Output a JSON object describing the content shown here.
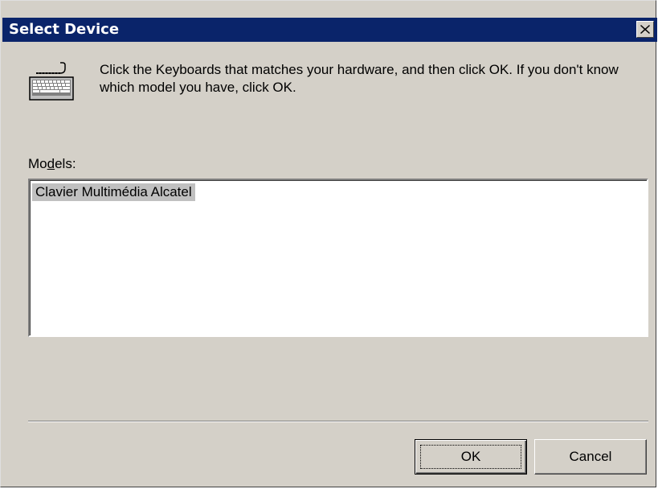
{
  "window": {
    "title": "Select Device",
    "close_icon": "close-icon"
  },
  "content": {
    "icon": "keyboard-icon",
    "instructions": "Click the Keyboards that matches your hardware, and then click OK. If you don't know which model you have, click OK.",
    "models_label_prefix": "Mo",
    "models_label_accel": "d",
    "models_label_suffix": "els:",
    "models": [
      {
        "label": "Clavier Multimédia Alcatel",
        "selected": true
      }
    ]
  },
  "buttons": {
    "ok_label": "OK",
    "cancel_label": "Cancel"
  },
  "colors": {
    "titlebar": "#0a246a",
    "dialog_face": "#d4d0c8",
    "selection": "#c0c0c0"
  }
}
